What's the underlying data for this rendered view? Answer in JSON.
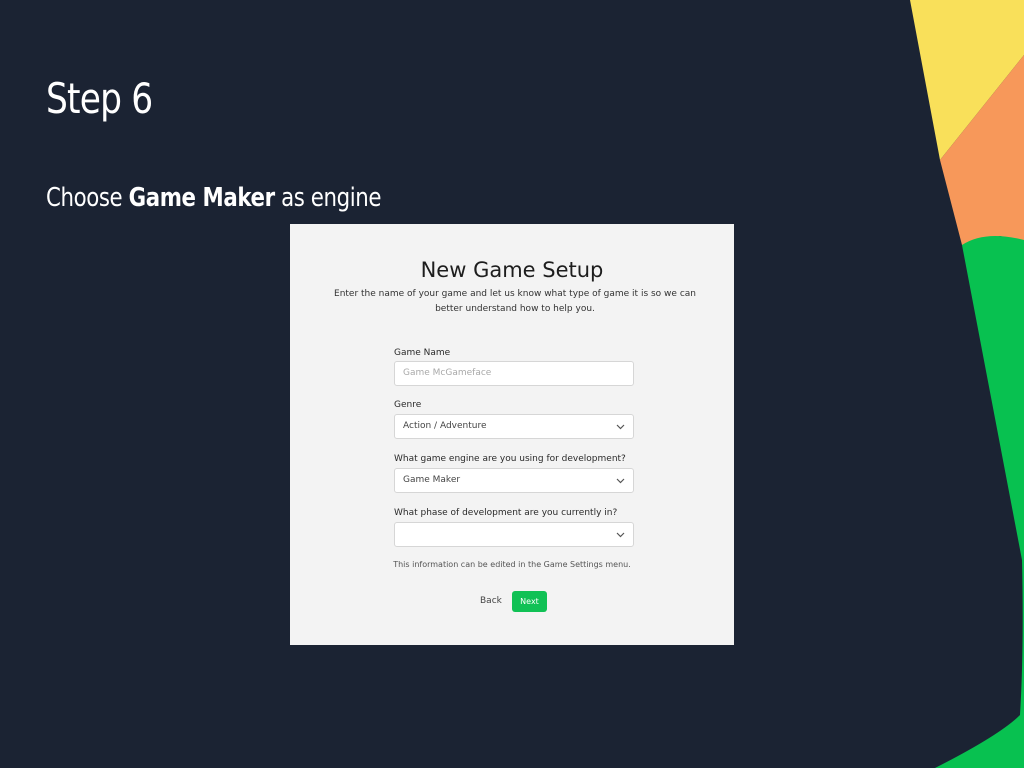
{
  "slide": {
    "title": "Step 6",
    "subtitle_prefix": "Choose ",
    "subtitle_emphasis": "Game Maker",
    "subtitle_suffix": " as engine"
  },
  "form": {
    "heading": "New Game Setup",
    "description": "Enter the name of your game and let us know what type of game it is so we can better understand how to help you.",
    "game_name": {
      "label": "Game Name",
      "placeholder": "Game McGameface",
      "value": ""
    },
    "genre": {
      "label": "Genre",
      "selected": "Action / Adventure"
    },
    "engine": {
      "label": "What game engine are you using for development?",
      "selected": "Game Maker"
    },
    "phase": {
      "label": "What phase of development are you currently in?",
      "selected": ""
    },
    "note": "This information can be edited in the Game Settings menu.",
    "back_label": "Back",
    "next_label": "Next"
  },
  "colors": {
    "background": "#1b2333",
    "accent_green": "#10c155",
    "decor_yellow": "#f9e05a",
    "decor_orange": "#f7985a",
    "decor_green": "#08c150"
  }
}
